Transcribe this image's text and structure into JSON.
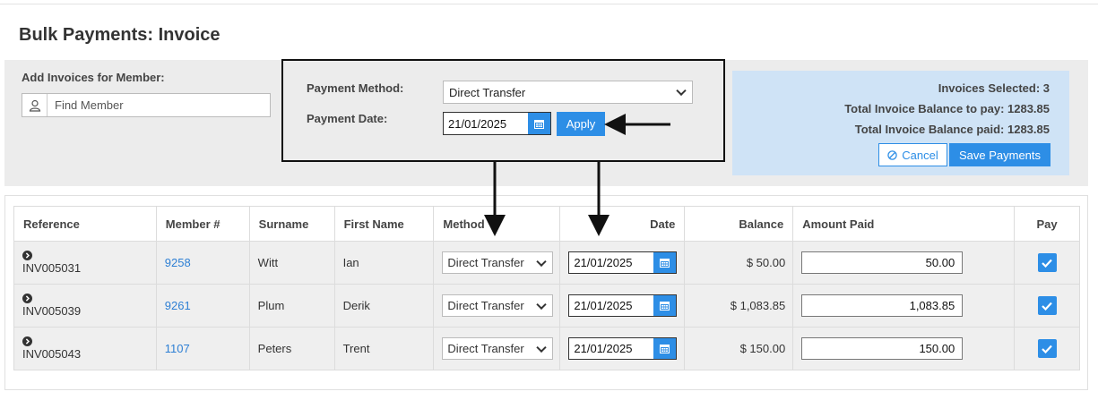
{
  "page": {
    "title": "Bulk Payments: Invoice"
  },
  "member": {
    "label": "Add Invoices for Member:",
    "placeholder": "Find Member",
    "icon": "user-icon"
  },
  "payment": {
    "method_label": "Payment Method:",
    "method_value": "Direct Transfer",
    "date_label": "Payment Date:",
    "date_value": "21/01/2025",
    "apply_label": "Apply"
  },
  "summary": {
    "invoices_selected": "Invoices Selected: 3",
    "total_to_pay": "Total Invoice Balance to pay: 1283.85",
    "total_paid": "Total Invoice Balance paid: 1283.85",
    "cancel_label": "Cancel",
    "save_label": "Save Payments"
  },
  "table": {
    "headers": [
      "Reference",
      "Member #",
      "Surname",
      "First Name",
      "Method",
      "Date",
      "Balance",
      "Amount Paid",
      "Pay"
    ],
    "rows": [
      {
        "reference": "INV005031",
        "member": "9258",
        "surname": "Witt",
        "first_name": "Ian",
        "method": "Direct Transfer",
        "date": "21/01/2025",
        "balance": "$ 50.00",
        "amount_paid": "50.00",
        "pay": true
      },
      {
        "reference": "INV005039",
        "member": "9261",
        "surname": "Plum",
        "first_name": "Derik",
        "method": "Direct Transfer",
        "date": "21/01/2025",
        "balance": "$ 1,083.85",
        "amount_paid": "1,083.85",
        "pay": true
      },
      {
        "reference": "INV005043",
        "member": "1107",
        "surname": "Peters",
        "first_name": "Trent",
        "method": "Direct Transfer",
        "date": "21/01/2025",
        "balance": "$ 150.00",
        "amount_paid": "150.00",
        "pay": true
      }
    ]
  },
  "colors": {
    "accent": "#2d8ee6",
    "summary_bg": "#cfe3f6",
    "panel_bg": "#ececec",
    "link": "#2d7fd4"
  }
}
